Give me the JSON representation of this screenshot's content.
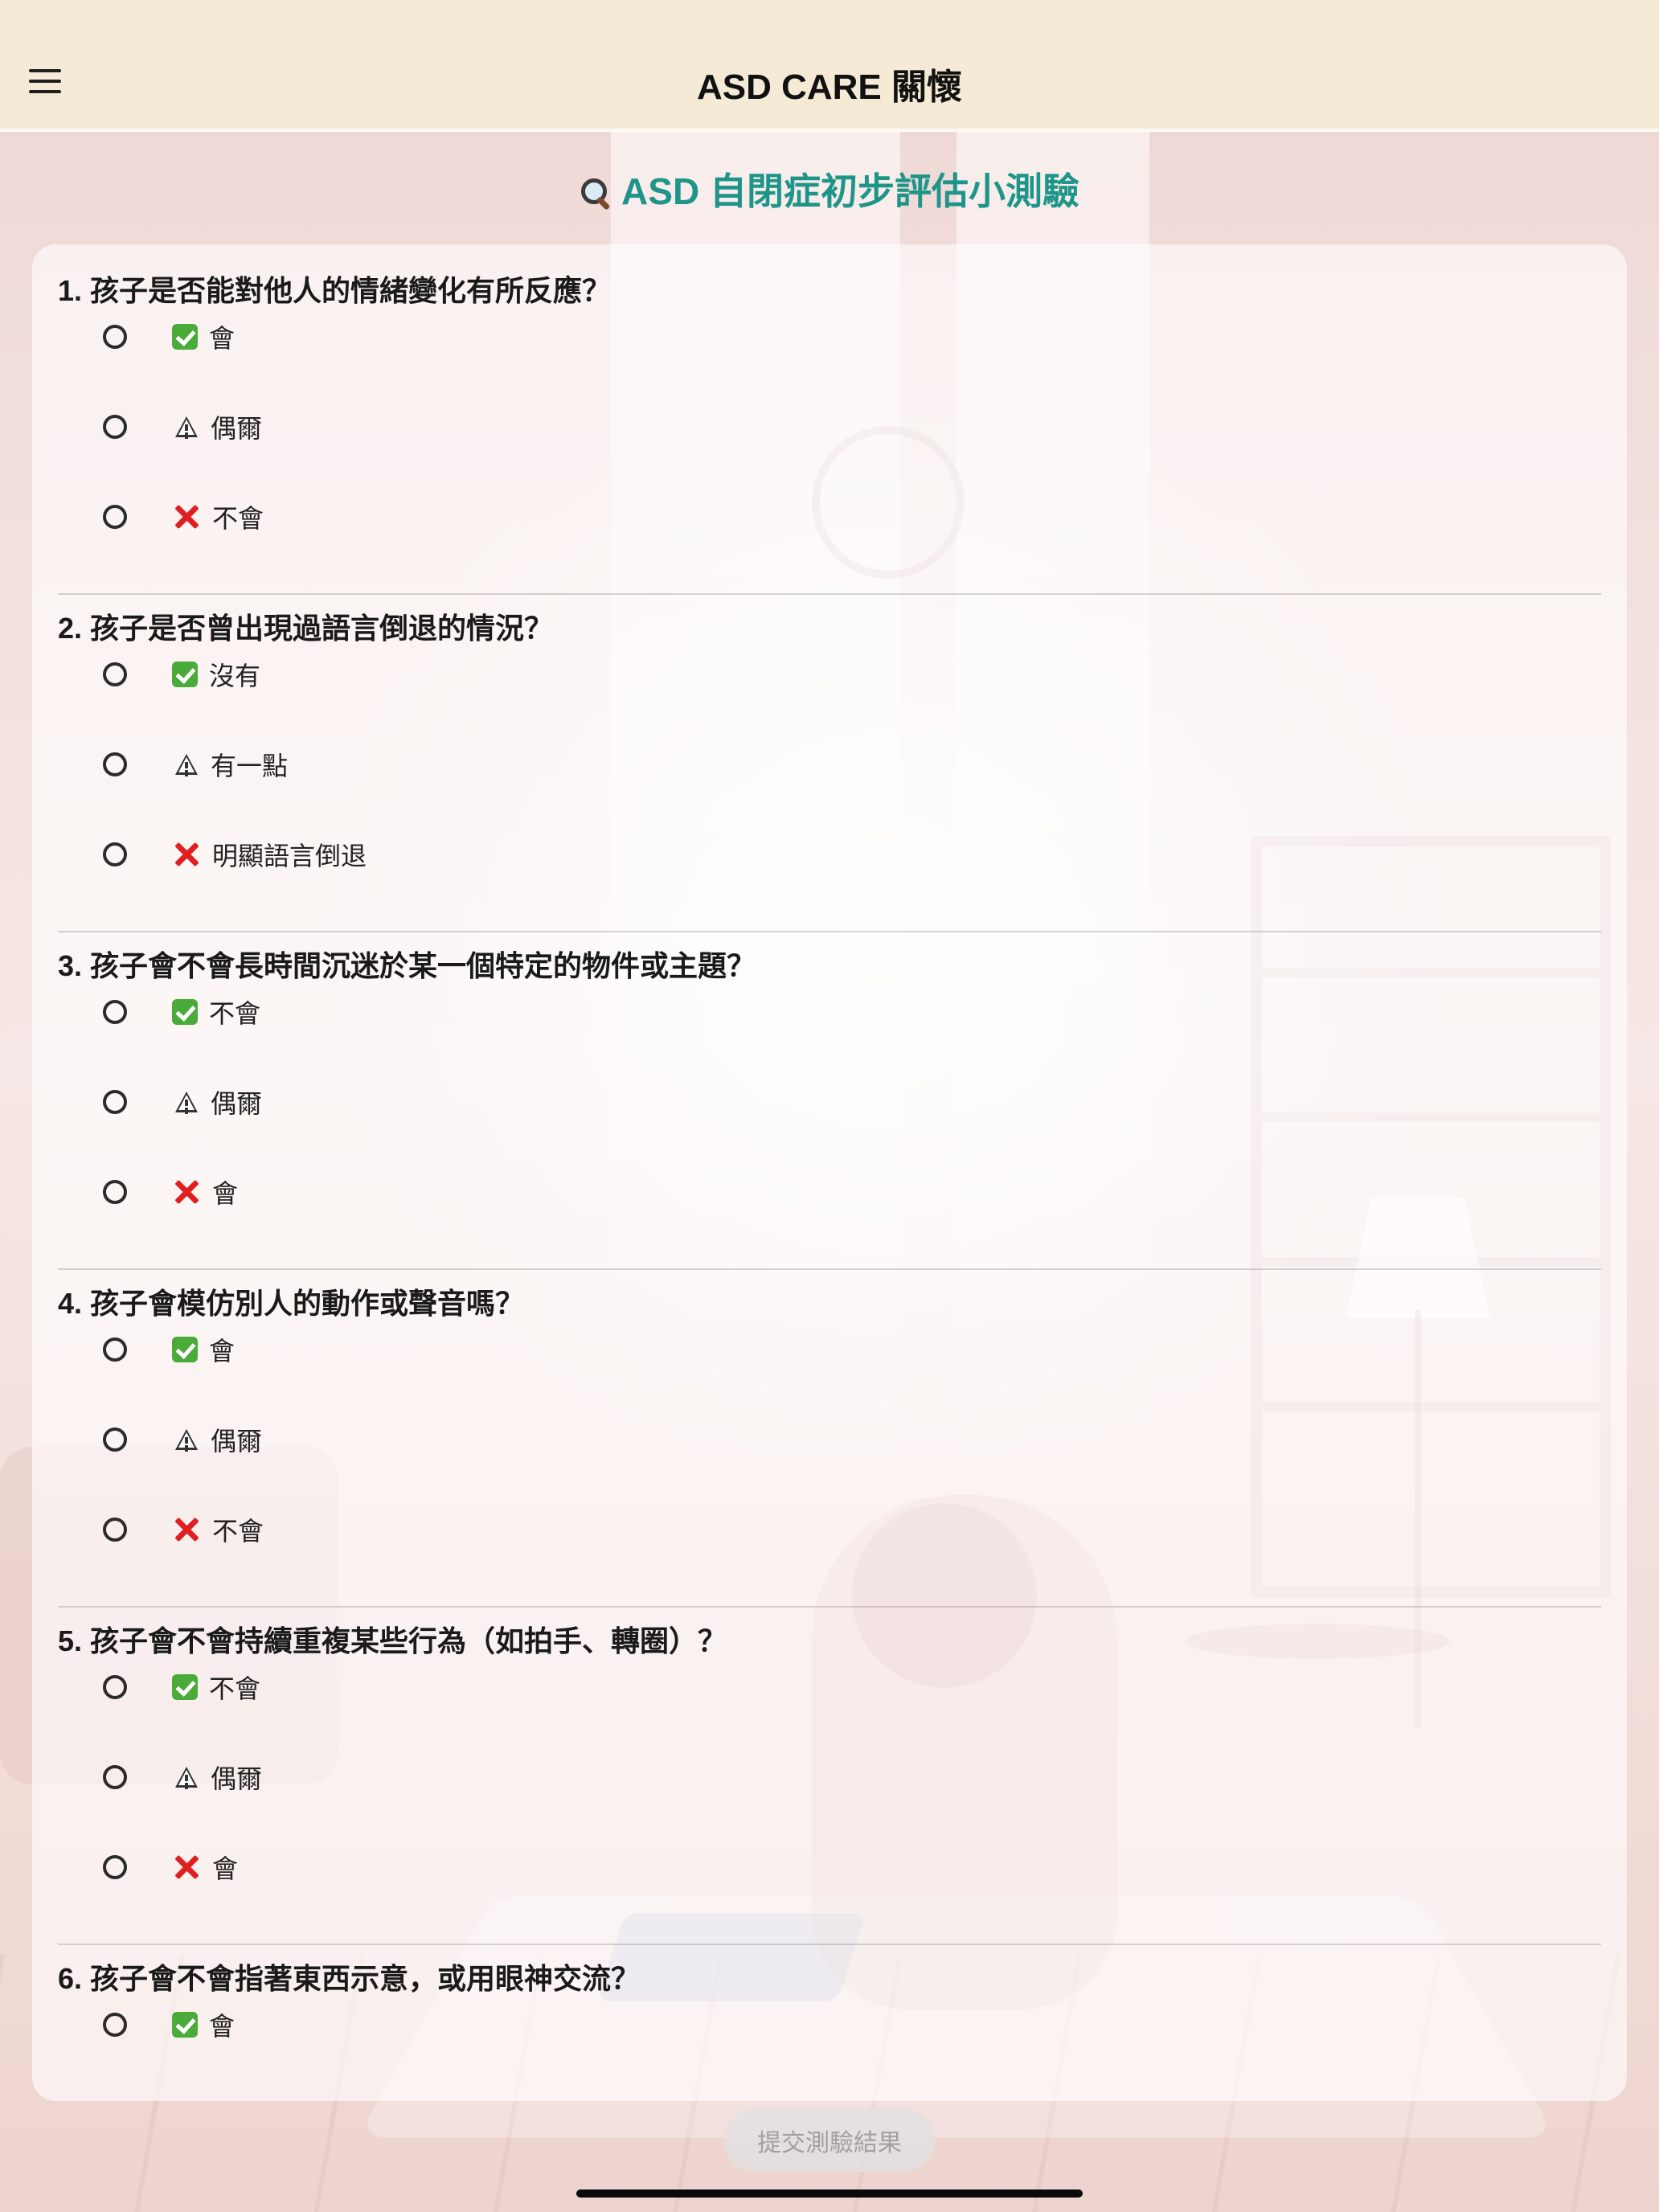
{
  "app": {
    "title": "ASD CARE 關懷"
  },
  "quiz": {
    "title": "ASD 自閉症初步評估小測驗",
    "questions": [
      {
        "text": "1. 孩子是否能對他人的情緒變化有所反應？",
        "options": [
          {
            "icon": "check-icon",
            "label": "會"
          },
          {
            "icon": "warning-icon",
            "label": "偶爾"
          },
          {
            "icon": "cross-icon",
            "label": "不會"
          }
        ]
      },
      {
        "text": "2. 孩子是否曾出現過語言倒退的情況？",
        "options": [
          {
            "icon": "check-icon",
            "label": "沒有"
          },
          {
            "icon": "warning-icon",
            "label": "有一點"
          },
          {
            "icon": "cross-icon",
            "label": "明顯語言倒退"
          }
        ]
      },
      {
        "text": "3. 孩子會不會長時間沉迷於某一個特定的物件或主題？",
        "options": [
          {
            "icon": "check-icon",
            "label": "不會"
          },
          {
            "icon": "warning-icon",
            "label": "偶爾"
          },
          {
            "icon": "cross-icon",
            "label": "會"
          }
        ]
      },
      {
        "text": "4. 孩子會模仿別人的動作或聲音嗎？",
        "options": [
          {
            "icon": "check-icon",
            "label": "會"
          },
          {
            "icon": "warning-icon",
            "label": "偶爾"
          },
          {
            "icon": "cross-icon",
            "label": "不會"
          }
        ]
      },
      {
        "text": "5. 孩子會不會持續重複某些行為（如拍手、轉圈）？",
        "options": [
          {
            "icon": "check-icon",
            "label": "不會"
          },
          {
            "icon": "warning-icon",
            "label": "偶爾"
          },
          {
            "icon": "cross-icon",
            "label": "會"
          }
        ]
      },
      {
        "text": "6. 孩子會不會指著東西示意，或用眼神交流？",
        "options": [
          {
            "icon": "check-icon",
            "label": "會"
          }
        ]
      }
    ],
    "submit_label": "提交測驗結果"
  },
  "colors": {
    "header_bg": "#f5ead5",
    "title_accent": "#1f9589",
    "check_green": "#4aaa3a",
    "cross_red": "#e02020"
  }
}
